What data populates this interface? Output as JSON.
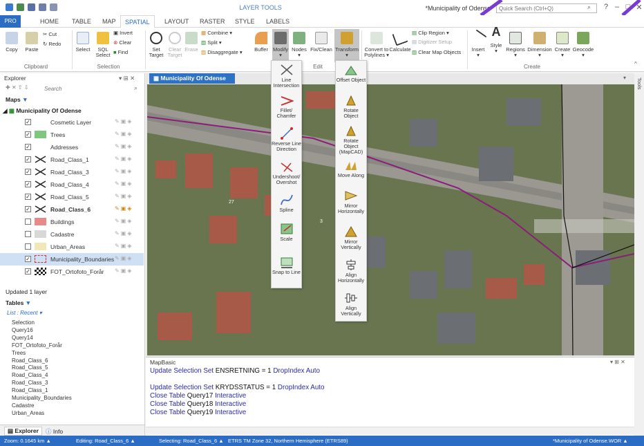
{
  "window": {
    "context_header": "LAYER TOOLS",
    "title": "*Municipality of Odense",
    "quick_search_placeholder": "Quick Search (Ctrl+Q)",
    "help": "?",
    "min": "–",
    "max": "□",
    "close": "✕"
  },
  "tabs": [
    "PRO",
    "HOME",
    "TABLE",
    "MAP",
    "SPATIAL",
    "LAYOUT",
    "RASTER",
    "STYLE",
    "LABELS"
  ],
  "ribbon": {
    "clipboard": {
      "copy": "Copy",
      "paste": "Paste",
      "cut": "Cut",
      "redo": "Redo",
      "group": "Clipboard"
    },
    "selection": {
      "select": "Select",
      "sql_select": "SQL Select",
      "invert": "Invert",
      "clear": "Clear",
      "find": "Find",
      "group": "Selection"
    },
    "edit": {
      "set_target": "Set Target",
      "clear_target": "Clear Target",
      "erase": "Erase",
      "combine": "Combine",
      "split": "Split",
      "disaggregate": "Disaggregate",
      "buffer": "Buffer",
      "modify": "Modify",
      "nodes": "Nodes",
      "fix_clean": "Fix/Clean",
      "transform": "Transform",
      "group": "Edit"
    },
    "create": {
      "convert": "Convert to Polylines",
      "calculate": "Calculate",
      "clip_region": "Clip Region",
      "digitizer": "Digitizer Setup",
      "clear_map_objects": "Clear Map Objects",
      "insert": "Insert",
      "style": "Style",
      "regions": "Regions",
      "dimension": "Dimension",
      "create": "Create",
      "geocode": "Geocode",
      "group": "Create"
    }
  },
  "explorer": {
    "title": "Explorer",
    "search_placeholder": "Search",
    "maps_label": "Maps",
    "map_name": "Municipality Of Odense",
    "layers": [
      {
        "name": "Cosmetic Layer",
        "checked": true,
        "bold": false,
        "swatch": "none"
      },
      {
        "name": "Trees",
        "checked": true,
        "bold": false,
        "swatch": "#7fc77f"
      },
      {
        "name": "Addresses",
        "checked": true,
        "bold": false,
        "swatch": "none"
      },
      {
        "name": "Road_Class_1",
        "checked": true,
        "bold": false,
        "swatch": "x"
      },
      {
        "name": "Road_Class_3",
        "checked": true,
        "bold": false,
        "swatch": "x"
      },
      {
        "name": "Road_Class_4",
        "checked": true,
        "bold": false,
        "swatch": "x"
      },
      {
        "name": "Road_Class_5",
        "checked": true,
        "bold": false,
        "swatch": "x"
      },
      {
        "name": "Road_Class_6",
        "checked": true,
        "bold": true,
        "swatch": "x"
      },
      {
        "name": "Buildings",
        "checked": false,
        "bold": false,
        "swatch": "#e88a88"
      },
      {
        "name": "Cadastre",
        "checked": false,
        "bold": false,
        "swatch": "#d8d8d8"
      },
      {
        "name": "Urban_Areas",
        "checked": false,
        "bold": false,
        "swatch": "#f2e7b8"
      },
      {
        "name": "Municipality_Boundaries",
        "checked": true,
        "bold": false,
        "swatch": "dash"
      },
      {
        "name": "FOT_Ortofoto_Forår",
        "checked": true,
        "bold": false,
        "swatch": "checker"
      }
    ],
    "status": "Updated 1 layer",
    "tables_label": "Tables",
    "list_filter": "List : Recent",
    "tables": [
      "Selection",
      "Query16",
      "Query14",
      "FOT_Ortofoto_Forår",
      "Trees",
      "Road_Class_6",
      "Road_Class_5",
      "Road_Class_4",
      "Road_Class_3",
      "Road_Class_1",
      "Municipality_Boundaries",
      "Cadastre",
      "Urban_Areas"
    ],
    "bottom_tabs": [
      "Explorer",
      "Info"
    ]
  },
  "map": {
    "tab_title": "Municipality Of Odense",
    "side_label": "Tools",
    "house_numbers": [
      "27",
      "3"
    ]
  },
  "modify_menu": [
    "Line Intersection",
    "Fillet/ Chamfer",
    "Reverse Line Direction",
    "Undershoot/ Overshot",
    "Spline",
    "Scale",
    "Snap to Line"
  ],
  "transform_menu": [
    "Offset Object",
    "Rotate Object",
    "Rotate Object (MapCAD)",
    "Move Along",
    "Mirror Horizontally",
    "Mirror Vertically",
    "Align Horizontally",
    "Align Vertically"
  ],
  "mapbasic": {
    "title": "MapBasic",
    "lines": [
      {
        "kw": "Update Selection Set",
        "obj": "ENSRETNING",
        "mid": " = 1 ",
        "tail": "DropIndex Auto"
      },
      {
        "kw": "Update Selection Set",
        "obj": "KRYDSSTATUS",
        "mid": " = 1 ",
        "tail": "DropIndex Auto"
      },
      {
        "kw": "Close Table",
        "obj": "Query17",
        "mid": " ",
        "tail": "Interactive"
      },
      {
        "kw": "Close Table",
        "obj": "Query18",
        "mid": " ",
        "tail": "Interactive"
      },
      {
        "kw": "Close Table",
        "obj": "Query19",
        "mid": " ",
        "tail": "Interactive"
      }
    ]
  },
  "status": {
    "zoom": "Zoom: 0.1645 km",
    "editing": "Editing: Road_Class_6",
    "selecting": "Selecting: Road_Class_6",
    "projection": "ETRS TM Zone 32, Northern Hemisphere (ETRS89)",
    "workspace": "*Municipality of Odense.WOR"
  },
  "colors": {
    "accent": "#2b6cc4",
    "road": "#8a1e7a"
  }
}
